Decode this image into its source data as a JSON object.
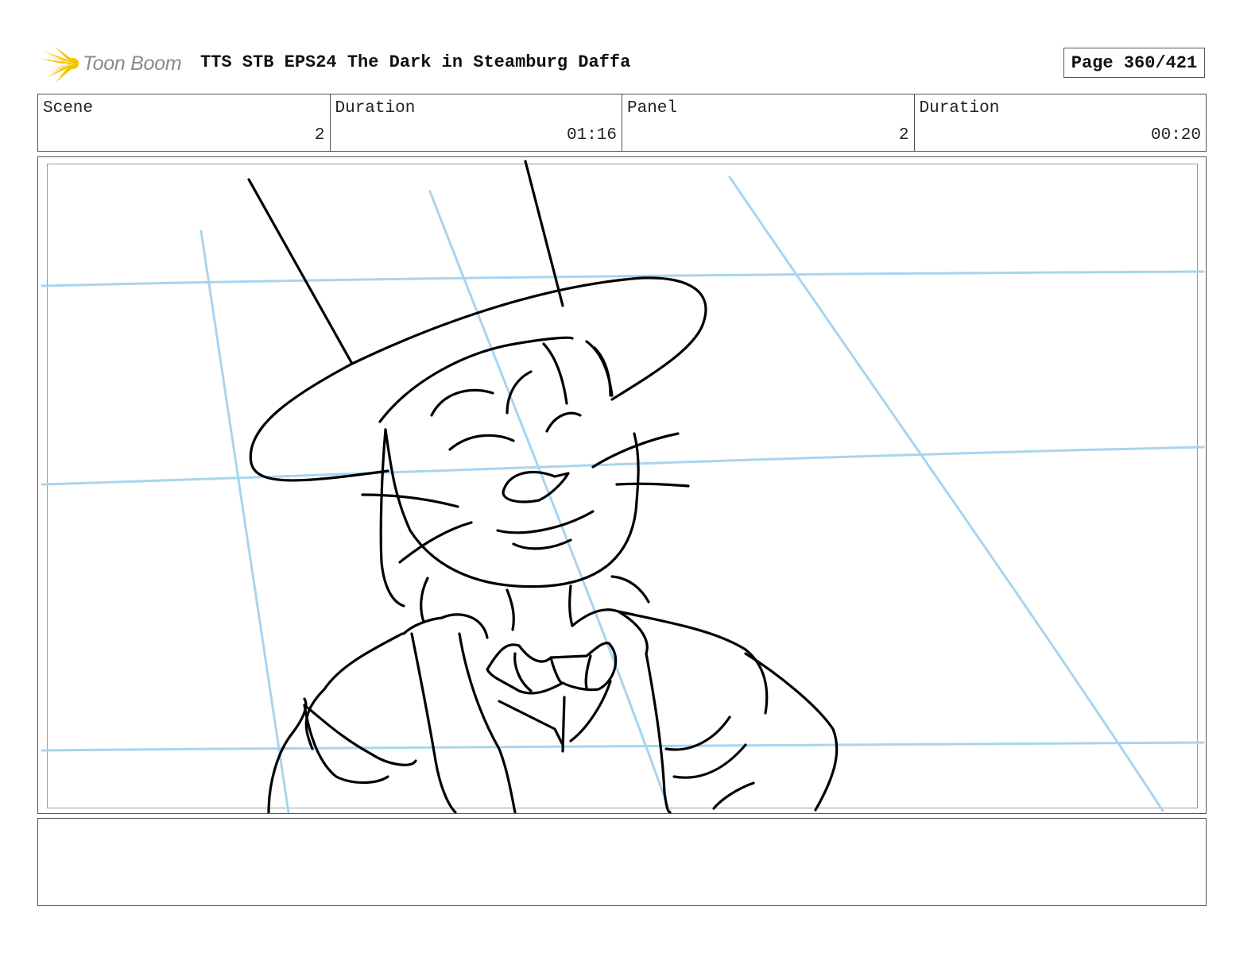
{
  "header": {
    "logo_text": "Toon Boom",
    "title": "TTS STB EPS24 The Dark in Steamburg Daffa",
    "page": "Page 360/421"
  },
  "info": {
    "scene_label": "Scene",
    "scene_value": "2",
    "scene_duration_label": "Duration",
    "scene_duration_value": "01:16",
    "panel_label": "Panel",
    "panel_value": "2",
    "panel_duration_label": "Duration",
    "panel_duration_value": "00:20"
  },
  "panel": {
    "sketch_subject": "character-with-wide-brim-hat-sketch",
    "guide_line_color": "#a8d4ef",
    "ink_color": "#000000"
  },
  "caption": {
    "text": ""
  },
  "colors": {
    "logo_burst": "#f5c400",
    "logo_text": "#8a8a8a",
    "border": "#555555"
  }
}
